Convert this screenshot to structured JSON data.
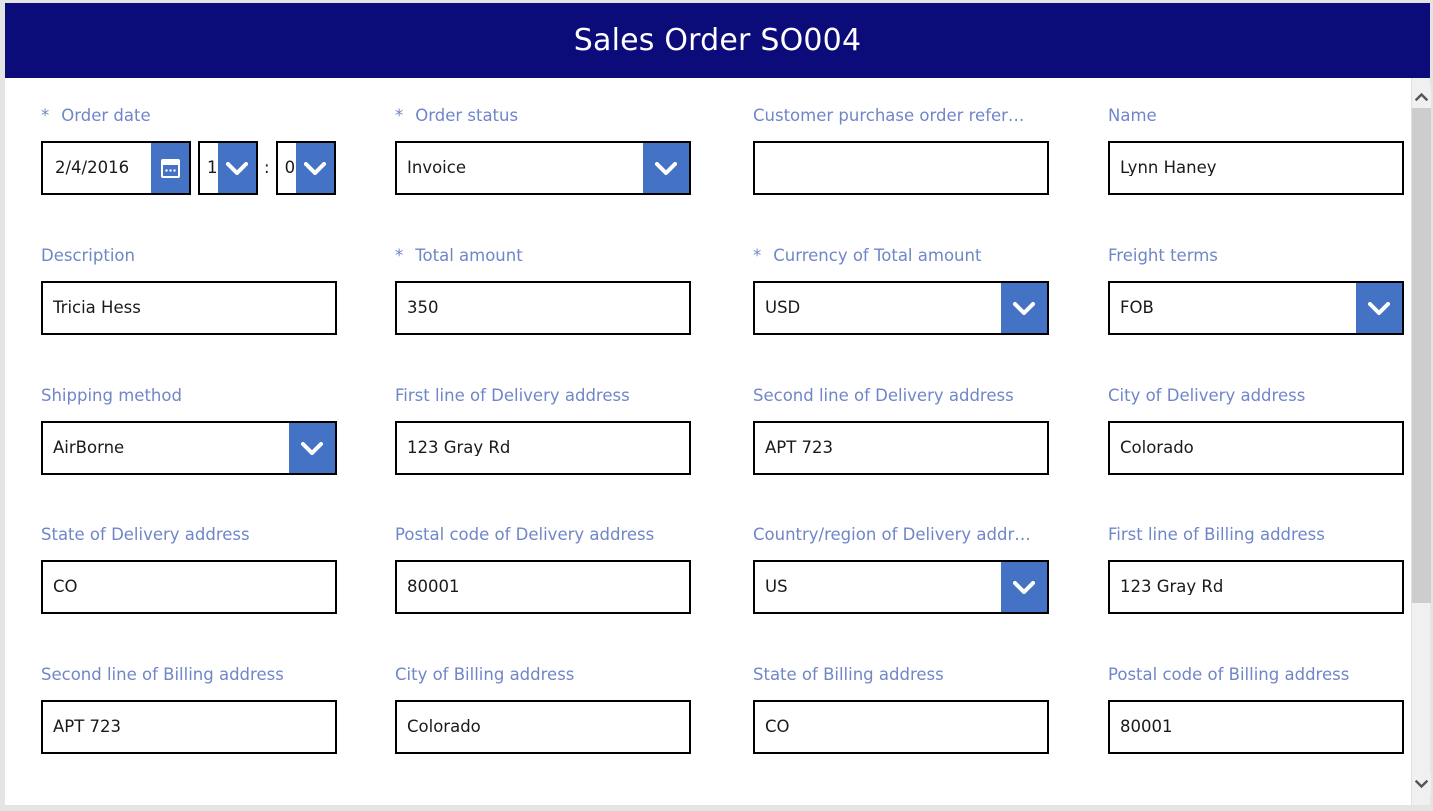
{
  "window": {
    "title": "Sales Order SO004",
    "header_color": "#0b0b7a",
    "accent_color": "#4472c4",
    "label_color": "#6f86c9",
    "required_marker": "*"
  },
  "form": {
    "order_date": {
      "label": "Order date",
      "required": true,
      "value": "2/4/2016",
      "hour": "1",
      "time_separator": ":",
      "minute": "0",
      "calendar_icon": "calendar-icon"
    },
    "fields": [
      {
        "key": "order-status",
        "label": "Order status",
        "required": true,
        "value": "Invoice",
        "type": "combobox"
      },
      {
        "key": "customer-purchase-order-reference",
        "label": "Customer purchase order refer…",
        "required": false,
        "value": "",
        "type": "text"
      },
      {
        "key": "name",
        "label": "Name",
        "required": false,
        "value": "Lynn Haney",
        "type": "text"
      },
      {
        "key": "description",
        "label": "Description",
        "required": false,
        "value": "Tricia Hess",
        "type": "text"
      },
      {
        "key": "total-amount",
        "label": "Total amount",
        "required": true,
        "value": "350",
        "type": "text"
      },
      {
        "key": "currency-of-total-amount",
        "label": "Currency of Total amount",
        "required": true,
        "value": "USD",
        "type": "combobox"
      },
      {
        "key": "freight-terms",
        "label": "Freight terms",
        "required": false,
        "value": "FOB",
        "type": "combobox"
      },
      {
        "key": "shipping-method",
        "label": "Shipping method",
        "required": false,
        "value": "AirBorne",
        "type": "combobox"
      },
      {
        "key": "first-line-of-delivery-address",
        "label": "First line of Delivery address",
        "required": false,
        "value": "123 Gray Rd",
        "type": "text"
      },
      {
        "key": "second-line-of-delivery-address",
        "label": "Second line of Delivery address",
        "required": false,
        "value": "APT 723",
        "type": "text"
      },
      {
        "key": "city-of-delivery-address",
        "label": "City of Delivery address",
        "required": false,
        "value": "Colorado",
        "type": "text"
      },
      {
        "key": "state-of-delivery-address",
        "label": "State of Delivery address",
        "required": false,
        "value": "CO",
        "type": "text"
      },
      {
        "key": "postal-code-of-delivery-address",
        "label": "Postal code of Delivery address",
        "required": false,
        "value": "80001",
        "type": "text"
      },
      {
        "key": "country-region-of-delivery-address",
        "label": "Country/region of Delivery addr…",
        "required": false,
        "value": "US",
        "type": "combobox"
      },
      {
        "key": "first-line-of-billing-address",
        "label": "First line of Billing address",
        "required": false,
        "value": "123 Gray Rd",
        "type": "text"
      },
      {
        "key": "second-line-of-billing-address",
        "label": "Second line of Billing address",
        "required": false,
        "value": "APT 723",
        "type": "text"
      },
      {
        "key": "city-of-billing-address",
        "label": "City of Billing address",
        "required": false,
        "value": "Colorado",
        "type": "text"
      },
      {
        "key": "state-of-billing-address",
        "label": "State of Billing address",
        "required": false,
        "value": "CO",
        "type": "text"
      },
      {
        "key": "postal-code-of-billing-address",
        "label": "Postal code of Billing address",
        "required": false,
        "value": "80001",
        "type": "text"
      }
    ]
  },
  "scrollbar": {
    "up_arrow_icon": "chevron-up-icon",
    "down_arrow_icon": "chevron-down-icon"
  }
}
